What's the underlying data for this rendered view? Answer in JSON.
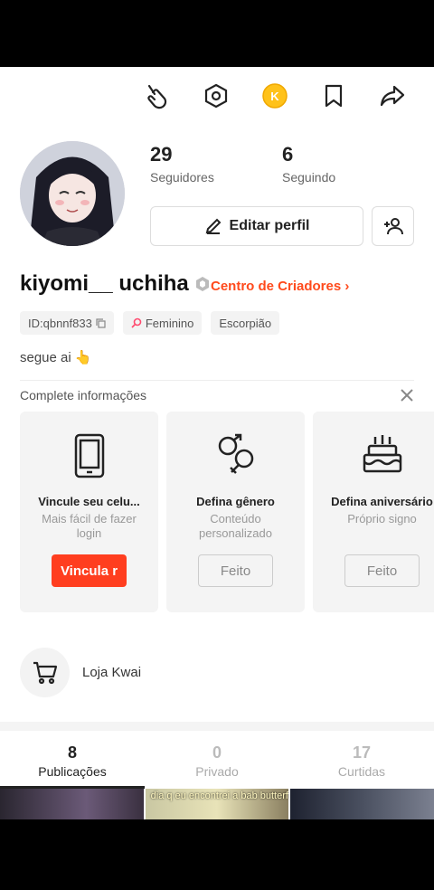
{
  "toolbar": {
    "icons": [
      "tap-hand-icon",
      "hexagon-settings-icon",
      "coin-icon",
      "bookmark-icon",
      "share-icon"
    ],
    "coin_symbol": "K",
    "accent_color": "#ff4a1c",
    "coin_color": "#ffc21a"
  },
  "profile": {
    "followers_count": "29",
    "followers_label": "Seguidores",
    "following_count": "6",
    "following_label": "Seguindo",
    "edit_label": "Editar perfil",
    "username": "kiyomi__ uchiha",
    "creator_link": "Centro de Criadores",
    "tags": {
      "id": "ID:qbnnf833",
      "gender": "Feminino",
      "sign": "Escorpião"
    },
    "bio": "segue ai 👆"
  },
  "complete_info": {
    "header": "Complete informações",
    "cards": [
      {
        "icon": "phone-icon",
        "title": "Vincule seu celu...",
        "desc": "Mais fácil de fazer login",
        "button": "Vincula r"
      },
      {
        "icon": "gender-icon",
        "title": "Defina gênero",
        "desc": "Conteúdo personalizado",
        "button": "Feito"
      },
      {
        "icon": "birthday-cake-icon",
        "title": "Defina aniversário",
        "desc": "Próprio signo",
        "button": "Feito"
      }
    ]
  },
  "shop": {
    "label": "Loja Kwai"
  },
  "tabs": [
    {
      "count": "8",
      "label": "Publicações"
    },
    {
      "count": "0",
      "label": "Privado"
    },
    {
      "count": "17",
      "label": "Curtidas"
    }
  ],
  "thumbnails": [
    {
      "caption": ""
    },
    {
      "caption": "dia q eu encontrei a bab butterfly Bellmel sem de"
    },
    {
      "caption": ""
    }
  ]
}
